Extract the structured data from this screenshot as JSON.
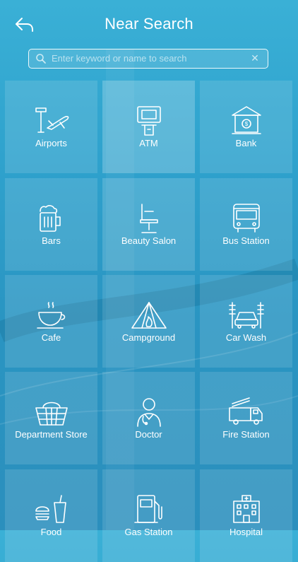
{
  "header": {
    "title": "Near Search"
  },
  "search": {
    "placeholder": "Enter keyword or name to search",
    "value": "",
    "clear_glyph": "✕"
  },
  "categories": [
    {
      "label": "Airports",
      "icon": "airport-icon"
    },
    {
      "label": "ATM",
      "icon": "atm-icon"
    },
    {
      "label": "Bank",
      "icon": "bank-icon"
    },
    {
      "label": "Bars",
      "icon": "beer-mug-icon"
    },
    {
      "label": "Beauty Salon",
      "icon": "salon-chair-icon"
    },
    {
      "label": "Bus Station",
      "icon": "bus-icon"
    },
    {
      "label": "Cafe",
      "icon": "coffee-cup-icon"
    },
    {
      "label": "Campground",
      "icon": "tent-icon"
    },
    {
      "label": "Car Wash",
      "icon": "car-wash-icon"
    },
    {
      "label": "Department Store",
      "icon": "basket-icon"
    },
    {
      "label": "Doctor",
      "icon": "doctor-icon"
    },
    {
      "label": "Fire Station",
      "icon": "fire-truck-icon"
    },
    {
      "label": "Food",
      "icon": "fast-food-icon"
    },
    {
      "label": "Gas Station",
      "icon": "gas-pump-icon"
    },
    {
      "label": "Hospital",
      "icon": "hospital-icon"
    }
  ]
}
